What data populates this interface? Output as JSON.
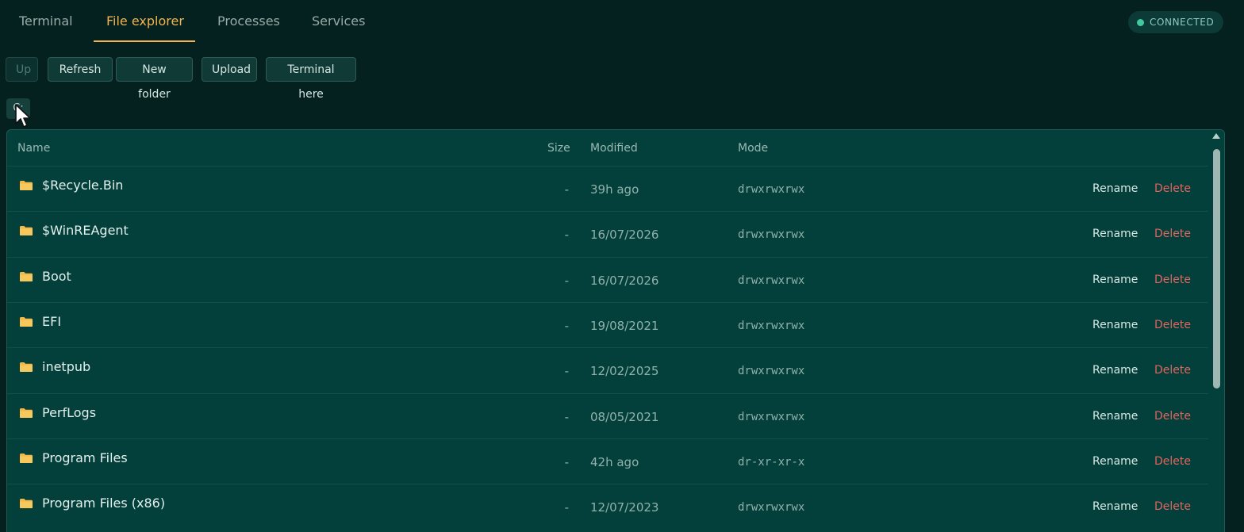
{
  "tabs": [
    {
      "label": "Terminal"
    },
    {
      "label": "File explorer"
    },
    {
      "label": "Processes"
    },
    {
      "label": "Services"
    }
  ],
  "active_tab": "File explorer",
  "status": {
    "label": "CONNECTED",
    "color": "#3fc9a0"
  },
  "toolbar": {
    "up": "Up",
    "refresh": "Refresh",
    "new_folder": "New folder",
    "upload": "Upload",
    "terminal_here": "Terminal here"
  },
  "path": {
    "label": "C:"
  },
  "table": {
    "columns": {
      "name": "Name",
      "size": "Size",
      "modified": "Modified",
      "mode": "Mode"
    },
    "rows": [
      {
        "name": "$Recycle.Bin",
        "size": "-",
        "modified": "39h ago",
        "mode": "drwxrwxrwx",
        "rename": "Rename",
        "delete": "Delete",
        "icon": "folder-icon"
      },
      {
        "name": "$WinREAgent",
        "size": "-",
        "modified": "16/07/2026",
        "mode": "drwxrwxrwx",
        "rename": "Rename",
        "delete": "Delete",
        "icon": "folder-icon"
      },
      {
        "name": "Boot",
        "size": "-",
        "modified": "16/07/2026",
        "mode": "drwxrwxrwx",
        "rename": "Rename",
        "delete": "Delete",
        "icon": "folder-icon"
      },
      {
        "name": "EFI",
        "size": "-",
        "modified": "19/08/2021",
        "mode": "drwxrwxrwx",
        "rename": "Rename",
        "delete": "Delete",
        "icon": "folder-icon"
      },
      {
        "name": "inetpub",
        "size": "-",
        "modified": "12/02/2025",
        "mode": "drwxrwxrwx",
        "rename": "Rename",
        "delete": "Delete",
        "icon": "folder-icon"
      },
      {
        "name": "PerfLogs",
        "size": "-",
        "modified": "08/05/2021",
        "mode": "drwxrwxrwx",
        "rename": "Rename",
        "delete": "Delete",
        "icon": "folder-icon"
      },
      {
        "name": "Program Files",
        "size": "-",
        "modified": "42h ago",
        "mode": "dr-xr-xr-x",
        "rename": "Rename",
        "delete": "Delete",
        "icon": "folder-icon"
      },
      {
        "name": "Program Files (x86)",
        "size": "-",
        "modified": "12/07/2023",
        "mode": "drwxrwxrwx",
        "rename": "Rename",
        "delete": "Delete",
        "icon": "folder-icon"
      }
    ]
  },
  "colors": {
    "accent": "#f2b44f",
    "background": "#04201f",
    "panel": "#04403b",
    "danger": "#e2645e"
  }
}
